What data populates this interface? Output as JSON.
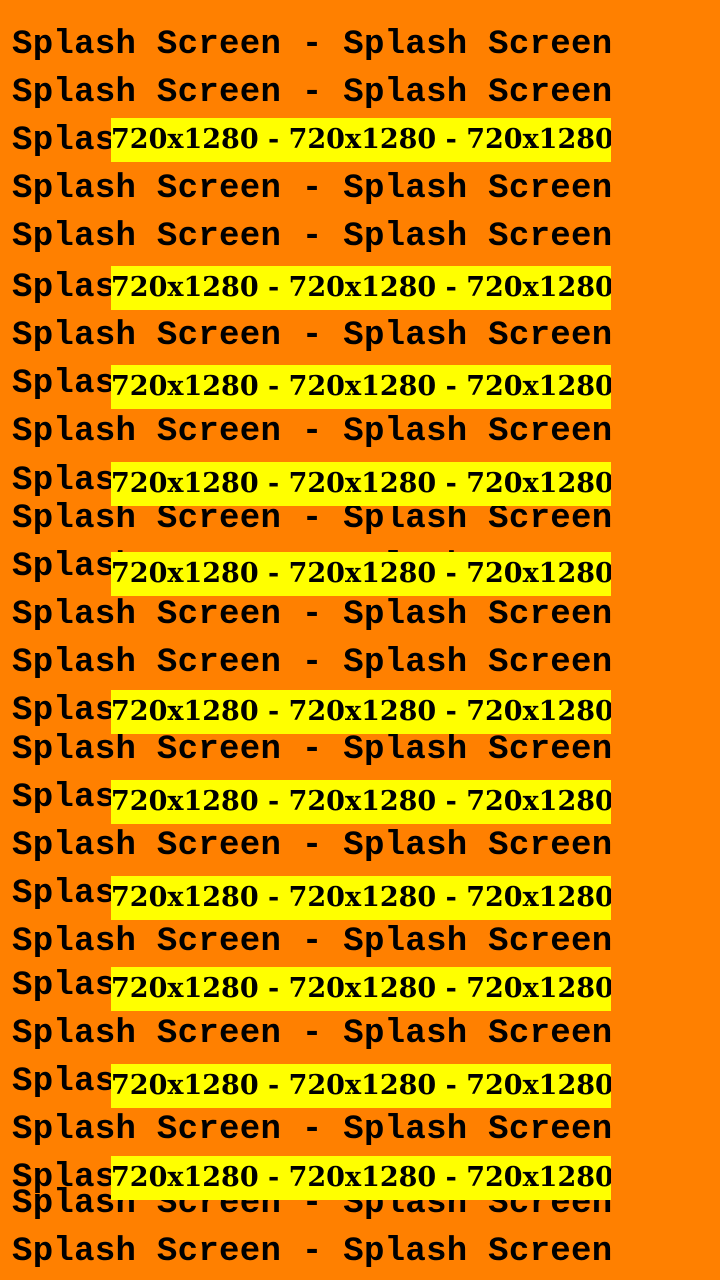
{
  "screen": {
    "background_color": "#FF8000",
    "band_color": "#FFFF00",
    "text_color": "#000000",
    "pattern_text": "Splash Screen - Splash Screen",
    "size_text": "720x1280 - 720x1280 - 720x1280"
  }
}
